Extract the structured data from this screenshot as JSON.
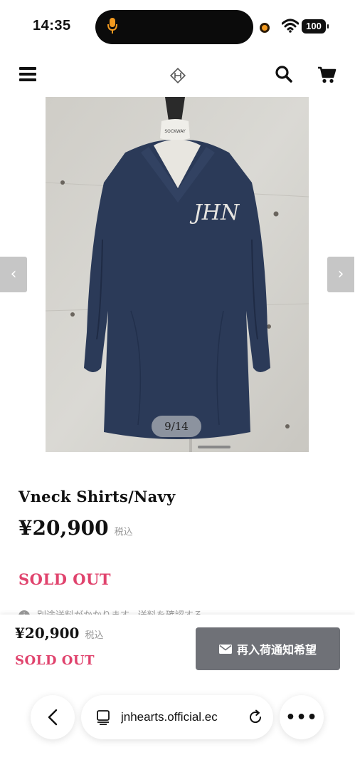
{
  "status_bar": {
    "time": "14:35",
    "battery": "100",
    "icons": [
      "microphone-icon",
      "recording-dot-icon",
      "wifi-icon",
      "battery-icon"
    ]
  },
  "header": {
    "icons": [
      "menu-icon",
      "brand-logo-icon",
      "search-icon",
      "cart-icon"
    ]
  },
  "gallery": {
    "counter": "9/14",
    "prev_icon": "‹",
    "next_icon": "›",
    "photo_monogram": "JHN",
    "mannequin_tag": "SOCKWAY"
  },
  "product": {
    "name": "Vneck Shirts/Navy",
    "price": "¥20,900",
    "tax_label": "税込",
    "status": "SOLD OUT",
    "shipping_note": "別途送料がかかります。送料を確認する"
  },
  "sticky_bar": {
    "price": "¥20,900",
    "tax_label": "税込",
    "status": "SOLD OUT",
    "restock_button": "再入荷通知希望"
  },
  "browser": {
    "url": "jnhearts.official.ec",
    "more_label": "•••"
  },
  "colors": {
    "sold_out": "#e0436d",
    "button_bg": "#6f7177",
    "shirt": "#2b3a58"
  }
}
